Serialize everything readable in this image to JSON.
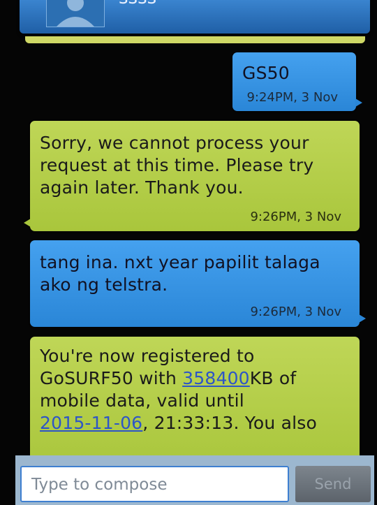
{
  "header": {
    "contact_name": "ssss"
  },
  "messages": [
    {
      "type": "sent",
      "text": "GS50",
      "time": "9:24PM, 3 Nov"
    },
    {
      "type": "received",
      "text": "Sorry, we cannot process your request at this time. Please try again later. Thank you.",
      "time": "9:26PM, 3 Nov"
    },
    {
      "type": "sent",
      "text": "tang ina. nxt year papilit talaga ako ng telstra.",
      "time": "9:26PM, 3 Nov"
    },
    {
      "type": "received",
      "line1": "You're now registered to",
      "line2_before": "GoSURF50 with ",
      "line2_link": "358400",
      "line2_after": "KB of",
      "line3": "mobile data, valid until",
      "line4_link": "2015-11-06",
      "line4_after": ", 21:33:13. You also"
    }
  ],
  "composer": {
    "placeholder": "Type to compose",
    "send_label": "Send"
  }
}
